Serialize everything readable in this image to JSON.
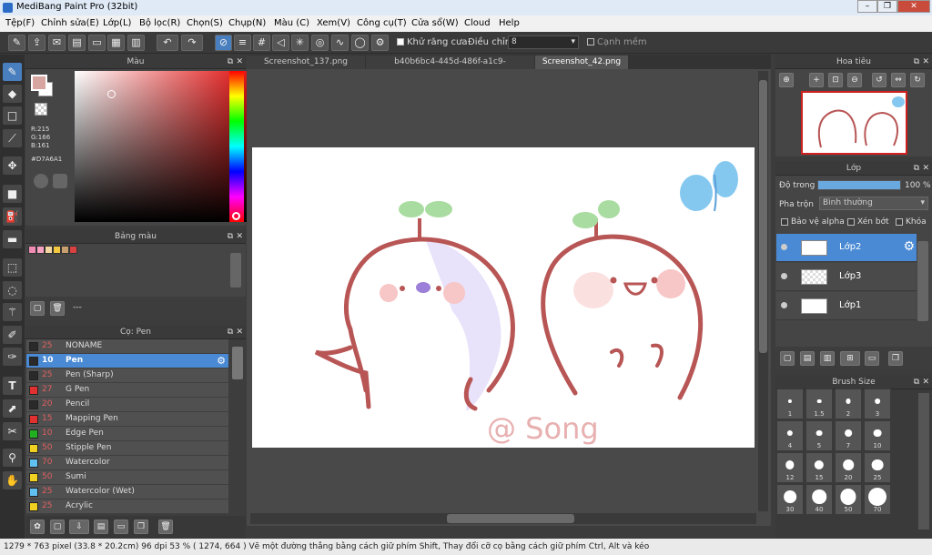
{
  "app": {
    "title": "MediBang Paint Pro (32bit)"
  },
  "menu": [
    "Tệp(F)",
    "Chỉnh sửa(E)",
    "Lớp(L)",
    "Bộ lọc(R)",
    "Chọn(S)",
    "Chụp(N)",
    "Màu (C)",
    "Xem(V)",
    "Công cụ(T)",
    "Cửa sổ(W)",
    "Cloud",
    "Help"
  ],
  "toolbar": {
    "antialias_label": "Khử răng cưa",
    "adjust_label": "Điều chỉnh",
    "adjust_value": "8",
    "smooth_label": "Cạnh mềm"
  },
  "color_panel": {
    "title": "Màu",
    "r": "R:215",
    "g": "G:166",
    "b": "B:161",
    "hex": "#D7A6A1",
    "primary": "#d7a6a1"
  },
  "palette_panel": {
    "title": "Bảng màu",
    "dash": "---",
    "swatches": [
      "#f08cb4",
      "#f5a3c0",
      "#f4d6a0",
      "#f5c842",
      "#c8a070",
      "#d94040"
    ]
  },
  "brush_panel": {
    "title": "Cọ: Pen",
    "brushes": [
      {
        "size": "25",
        "name": "NONAME",
        "color": "#2a2a2a"
      },
      {
        "size": "10",
        "name": "Pen",
        "color": "#2a2a2a"
      },
      {
        "size": "25",
        "name": "Pen (Sharp)",
        "color": "#2a2a2a"
      },
      {
        "size": "27",
        "name": "G Pen",
        "color": "#e03030"
      },
      {
        "size": "20",
        "name": "Pencil",
        "color": "#2a2a2a"
      },
      {
        "size": "15",
        "name": "Mapping Pen",
        "color": "#e03030"
      },
      {
        "size": "10",
        "name": "Edge Pen",
        "color": "#20b020"
      },
      {
        "size": "50",
        "name": "Stipple Pen",
        "color": "#f0d020"
      },
      {
        "size": "70",
        "name": "Watercolor",
        "color": "#60c0f0"
      },
      {
        "size": "50",
        "name": "Sumi",
        "color": "#f0d020"
      },
      {
        "size": "25",
        "name": "Watercolor (Wet)",
        "color": "#60c0f0"
      },
      {
        "size": "25",
        "name": "Acrylic",
        "color": "#f0d020"
      }
    ]
  },
  "tabs": [
    "Screenshot_137.png",
    "b40b6bc4-445d-486f-a1c9-af263faa384c.jpg",
    "Screenshot_42.png"
  ],
  "navigator": {
    "title": "Hoa tiêu"
  },
  "layer_panel": {
    "title": "Lớp",
    "opacity_label": "Độ trong",
    "opacity_value": "100 %",
    "opacity": 1.0,
    "blend_label": "Pha trộn",
    "blend_value": "Bình thường",
    "alpha_label": "Bảo vệ alpha",
    "clip_label": "Xén bớt",
    "lock_label": "Khóa",
    "layers": [
      "Lớp2",
      "Lớp3",
      "Lớp1"
    ]
  },
  "brush_size_panel": {
    "title": "Brush Size",
    "sizes": [
      "1",
      "1.5",
      "2",
      "3",
      "4",
      "5",
      "7",
      "10",
      "12",
      "15",
      "20",
      "25",
      "30",
      "40",
      "50",
      "70"
    ]
  },
  "canvas": {
    "signature": "@ Song"
  },
  "status": "1279 * 763 pixel   (33.8 * 20.2cm)   96 dpi   53 %   ( 1274, 664 )   Vẽ một đường thẳng bằng cách giữ phím Shift, Thay đổi cỡ cọ bằng cách giữ phím Ctrl, Alt và kéo"
}
